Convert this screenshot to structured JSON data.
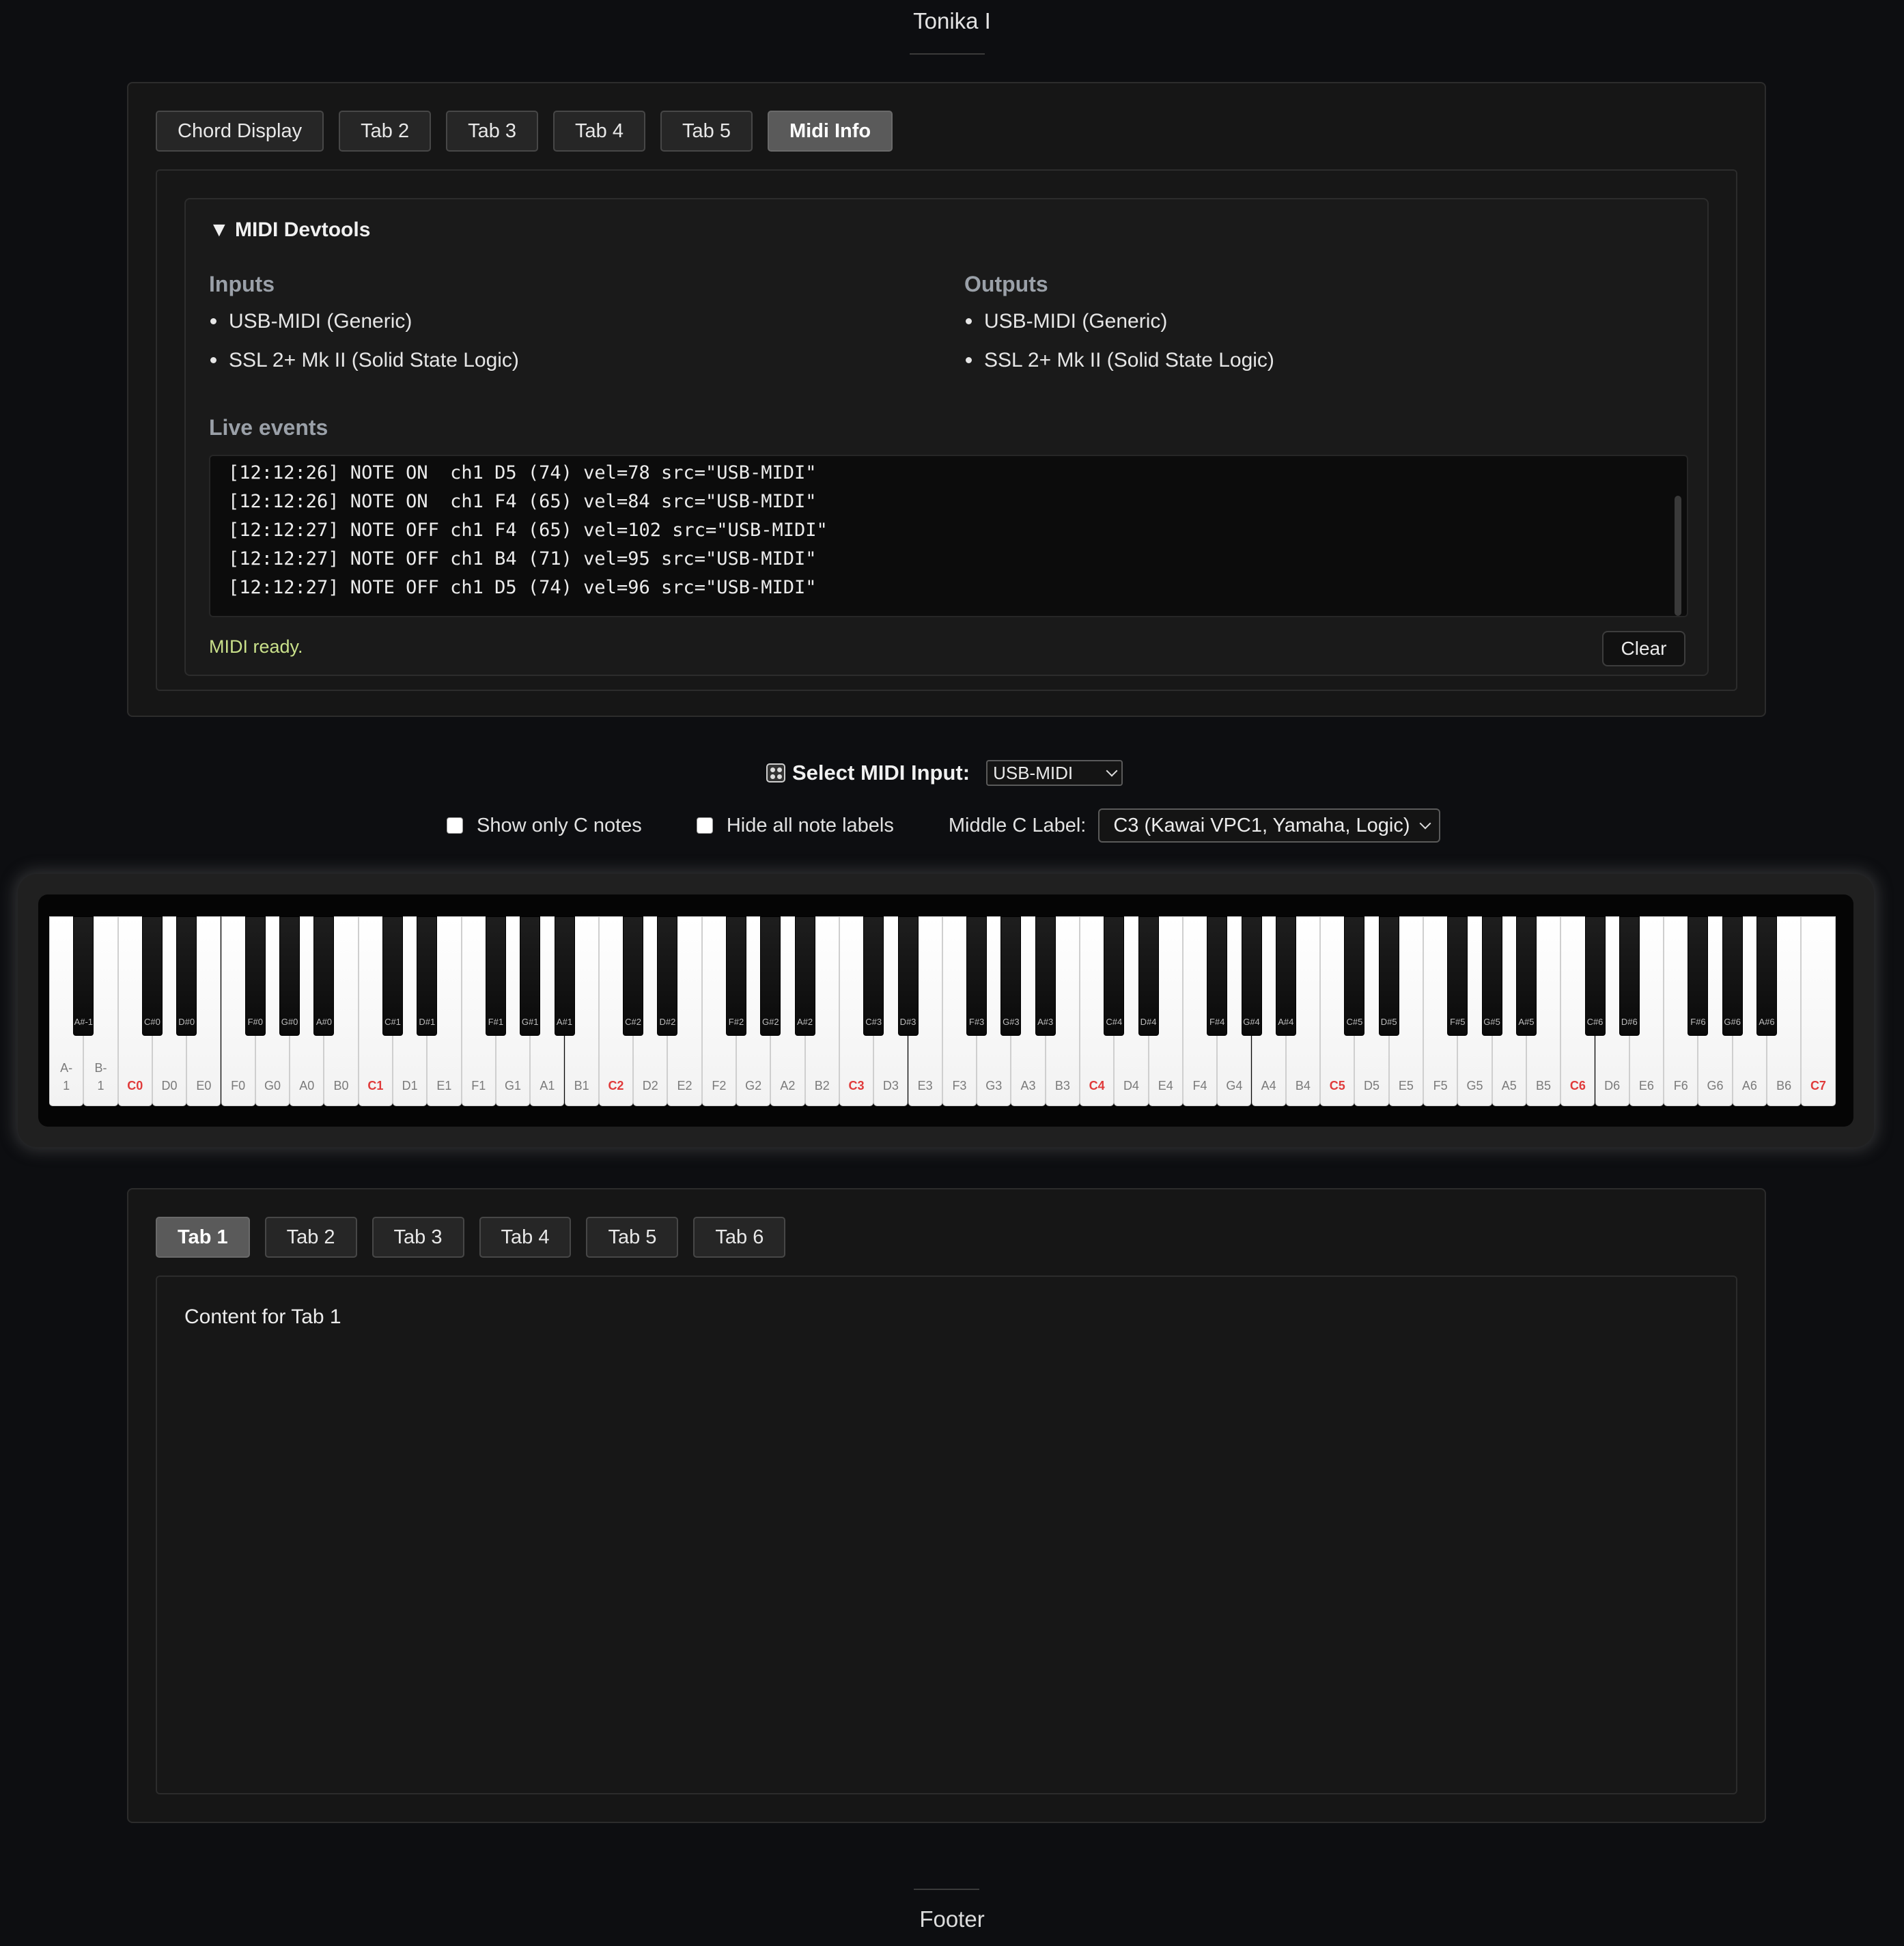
{
  "app": {
    "title": "Tonika I"
  },
  "top_panel": {
    "tabs": [
      "Chord Display",
      "Tab 2",
      "Tab 3",
      "Tab 4",
      "Tab 5",
      "Midi Info"
    ],
    "active_tab": "Midi Info"
  },
  "devtools": {
    "summary": "▼ MIDI Devtools",
    "inputs_heading": "Inputs",
    "inputs": [
      "USB-MIDI (Generic)",
      "SSL 2+ Mk II (Solid State Logic)"
    ],
    "outputs_heading": "Outputs",
    "outputs": [
      "USB-MIDI (Generic)",
      "SSL 2+ Mk II (Solid State Logic)"
    ],
    "live_heading": "Live events",
    "log": [
      "[12:12:26] NOTE ON  ch1 D5 (74) vel=78 src=\"USB-MIDI\"",
      "[12:12:26] NOTE ON  ch1 F4 (65) vel=84 src=\"USB-MIDI\"",
      "[12:12:27] NOTE OFF ch1 F4 (65) vel=102 src=\"USB-MIDI\"",
      "[12:12:27] NOTE OFF ch1 B4 (71) vel=95 src=\"USB-MIDI\"",
      "[12:12:27] NOTE OFF ch1 D5 (74) vel=96 src=\"USB-MIDI\""
    ],
    "status": "MIDI ready.",
    "clear_label": "Clear"
  },
  "midi_select": {
    "label": "Select MIDI Input:",
    "value": "USB-MIDI"
  },
  "options": {
    "show_only_c": {
      "label": "Show only C notes",
      "checked": false
    },
    "hide_labels": {
      "label": "Hide all note labels",
      "checked": false
    },
    "middle_c_label": "Middle C Label:",
    "middle_c_value": "C3 (Kawai VPC1, Yamaha, Logic)"
  },
  "keyboard": {
    "white_keys": [
      "A-1",
      "B-1",
      "C0",
      "D0",
      "E0",
      "F0",
      "G0",
      "A0",
      "B0",
      "C1",
      "D1",
      "E1",
      "F1",
      "G1",
      "A1",
      "B1",
      "C2",
      "D2",
      "E2",
      "F2",
      "G2",
      "A2",
      "B2",
      "C3",
      "D3",
      "E3",
      "F3",
      "G3",
      "A3",
      "B3",
      "C4",
      "D4",
      "E4",
      "F4",
      "G4",
      "A4",
      "B4",
      "C5",
      "D5",
      "E5",
      "F5",
      "G5",
      "A5",
      "B5",
      "C6",
      "D6",
      "E6",
      "F6",
      "G6",
      "A6",
      "B6",
      "C7"
    ],
    "black_keys": [
      "A#-1",
      "C#0",
      "D#0",
      "F#0",
      "G#0",
      "A#0",
      "C#1",
      "D#1",
      "F#1",
      "G#1",
      "A#1",
      "C#2",
      "D#2",
      "F#2",
      "G#2",
      "A#2",
      "C#3",
      "D#3",
      "F#3",
      "G#3",
      "A#3",
      "C#4",
      "D#4",
      "F#4",
      "G#4",
      "A#4",
      "C#5",
      "D#5",
      "F#5",
      "G#5",
      "A#5",
      "C#6",
      "D#6",
      "F#6",
      "G#6",
      "A#6"
    ],
    "c_note_color": "#e03b3b"
  },
  "bottom_panel": {
    "tabs": [
      "Tab 1",
      "Tab 2",
      "Tab 3",
      "Tab 4",
      "Tab 5",
      "Tab 6"
    ],
    "active_tab": "Tab 1",
    "content": "Content for Tab 1"
  },
  "footer": {
    "text": "Footer"
  }
}
